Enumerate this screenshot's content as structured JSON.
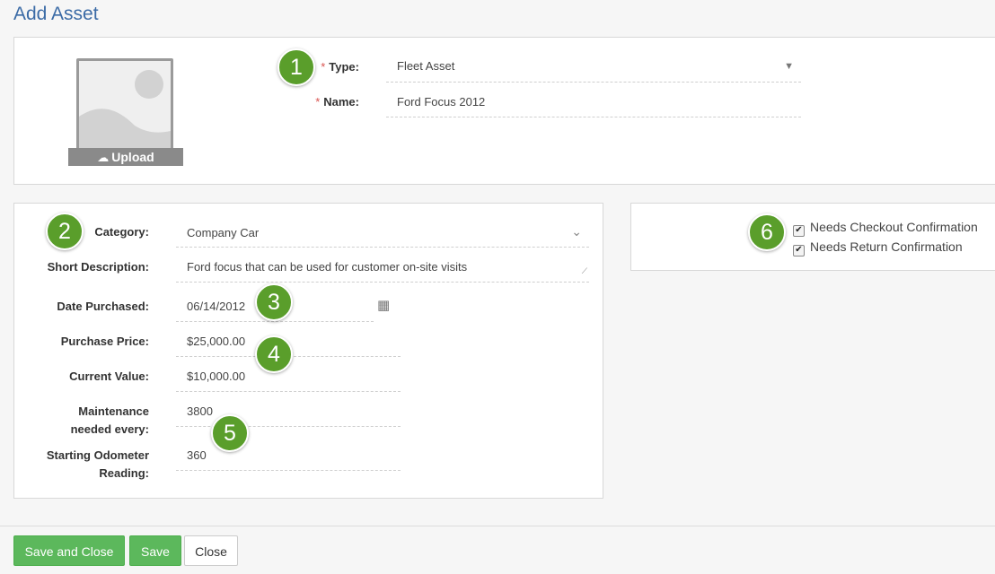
{
  "page_title": "Add Asset",
  "image_upload": {
    "label": "Upload",
    "icon": "cloud-upload-icon"
  },
  "type_field": {
    "label": "Type:",
    "value": "Fleet Asset",
    "required": true
  },
  "name_field": {
    "label": "Name:",
    "value": "Ford Focus 2012",
    "required": true
  },
  "details": {
    "category": {
      "label": "Category:",
      "value": "Company Car"
    },
    "short_description": {
      "label": "Short Description:",
      "value": "Ford focus that can be used for customer on-site visits"
    },
    "date_purchased": {
      "label": "Date Purchased:",
      "value": "06/14/2012"
    },
    "purchase_price": {
      "label": "Purchase Price:",
      "value": "$25,000.00"
    },
    "current_value": {
      "label": "Current Value:",
      "value": "$10,000.00"
    },
    "maintenance": {
      "label_line1": "Maintenance",
      "label_line2": "needed every:",
      "value": "3800"
    },
    "odometer": {
      "label_line1": "Starting Odometer",
      "label_line2": "Reading:",
      "value": "360"
    }
  },
  "options": {
    "checkout": {
      "label": "Needs Checkout Confirmation",
      "checked": true
    },
    "return": {
      "label": "Needs Return Confirmation",
      "checked": true
    }
  },
  "badges": [
    "1",
    "2",
    "3",
    "4",
    "5",
    "6"
  ],
  "buttons": {
    "save_close": "Save and Close",
    "save": "Save",
    "close": "Close"
  },
  "colors": {
    "title": "#3b6ba6",
    "badge": "#5a9e2b",
    "primary_button": "#5cb85c",
    "required": "#d9534f"
  }
}
